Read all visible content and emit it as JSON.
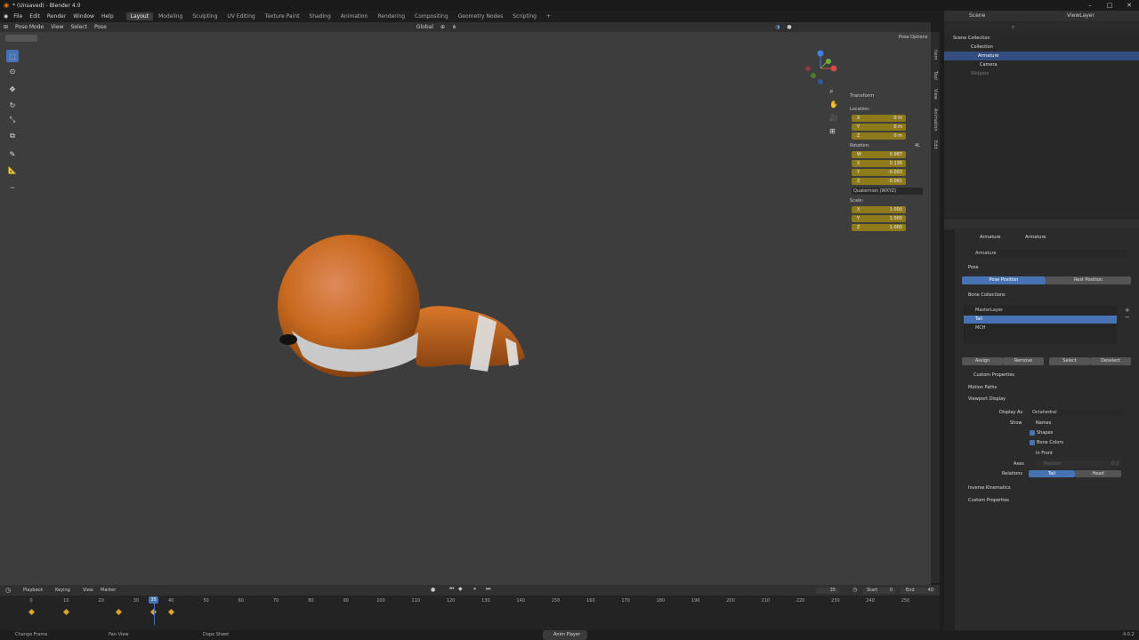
{
  "window": {
    "title": "* (Unsaved) - Blender 4.0"
  },
  "menu": {
    "items": [
      "File",
      "Edit",
      "Render",
      "Window",
      "Help"
    ]
  },
  "workspaces": [
    "Layout",
    "Modeling",
    "Sculpting",
    "UV Editing",
    "Texture Paint",
    "Shading",
    "Animation",
    "Rendering",
    "Compositing",
    "Geometry Nodes",
    "Scripting",
    "+"
  ],
  "viewport_header": {
    "mode": "Pose Mode",
    "view": "View",
    "select": "Select",
    "pose": "Pose",
    "orientation": "Global",
    "pose_options": "Pose Options"
  },
  "npanel": {
    "title": "Transform",
    "location_label": "Location:",
    "location": [
      {
        "ax": "X",
        "v": "0 m"
      },
      {
        "ax": "Y",
        "v": "0 m"
      },
      {
        "ax": "Z",
        "v": "0 m"
      }
    ],
    "rotation_label": "Rotation:",
    "rotation_4l": "4L",
    "rotation": [
      {
        "ax": "W",
        "v": "0.987"
      },
      {
        "ax": "X",
        "v": "0.136"
      },
      {
        "ax": "Y",
        "v": "-0.003"
      },
      {
        "ax": "Z",
        "v": "-0.081"
      }
    ],
    "rotation_mode": "Quaternion (WXYZ)",
    "scale_label": "Scale:",
    "scale": [
      {
        "ax": "X",
        "v": "1.000"
      },
      {
        "ax": "Y",
        "v": "1.000"
      },
      {
        "ax": "Z",
        "v": "1.000"
      }
    ]
  },
  "sidetabs": [
    "Item",
    "Tool",
    "View",
    "Animation",
    "Edit"
  ],
  "outliner": {
    "scene": "Scene",
    "view_layer": "ViewLayer",
    "rows": [
      "Scene Collection",
      "Collection",
      "Armature",
      "Camera",
      "Widgets"
    ]
  },
  "properties": {
    "breadcrumb_a": "Armature",
    "breadcrumb_b": "Armature",
    "name_field": "Armature",
    "pose_section": "Pose",
    "pose_position": "Pose Position",
    "rest_position": "Rest Position",
    "bone_collections": "Bone Collections",
    "collections": [
      "MasterLayer",
      "Tail",
      "MCH"
    ],
    "assign": "Assign",
    "remove": "Remove",
    "select": "Select",
    "deselect": "Deselect",
    "custom_props_inner": "Custom Properties",
    "motion_paths": "Motion Paths",
    "viewport_display": "Viewport Display",
    "display_as_label": "Display As",
    "display_as_value": "Octahedral",
    "show_label": "Show",
    "show_names": "Names",
    "show_shapes": "Shapes",
    "show_bone_colors": "Bone Colors",
    "show_in_front": "In Front",
    "axes_label": "Axes",
    "position_label": "Position",
    "position_value": "0.0",
    "relations_label": "Relations",
    "rel_tail": "Tail",
    "rel_head": "Head",
    "inverse_kinematics": "Inverse Kinematics",
    "custom_props": "Custom Properties"
  },
  "timeline": {
    "playback": "Playback",
    "keying": "Keying",
    "view": "View",
    "marker": "Marker",
    "current_frame": "35",
    "start_label": "Start",
    "start": "0",
    "end_label": "End",
    "end": "40",
    "ticks": [
      "0",
      "10",
      "20",
      "30",
      "40",
      "50",
      "60",
      "70",
      "80",
      "90",
      "100",
      "110",
      "120",
      "130",
      "140",
      "150",
      "160",
      "170",
      "180",
      "190",
      "200",
      "210",
      "220",
      "230",
      "240",
      "250"
    ],
    "keyframes": [
      0,
      10,
      25,
      35,
      40
    ],
    "playhead_frame": 35
  },
  "status": {
    "change_frame": "Change Frame",
    "pan_view": "Pan View",
    "dope_sheet": "Dope Sheet",
    "anim_player": "Anim Player",
    "version": "4.0.2"
  }
}
